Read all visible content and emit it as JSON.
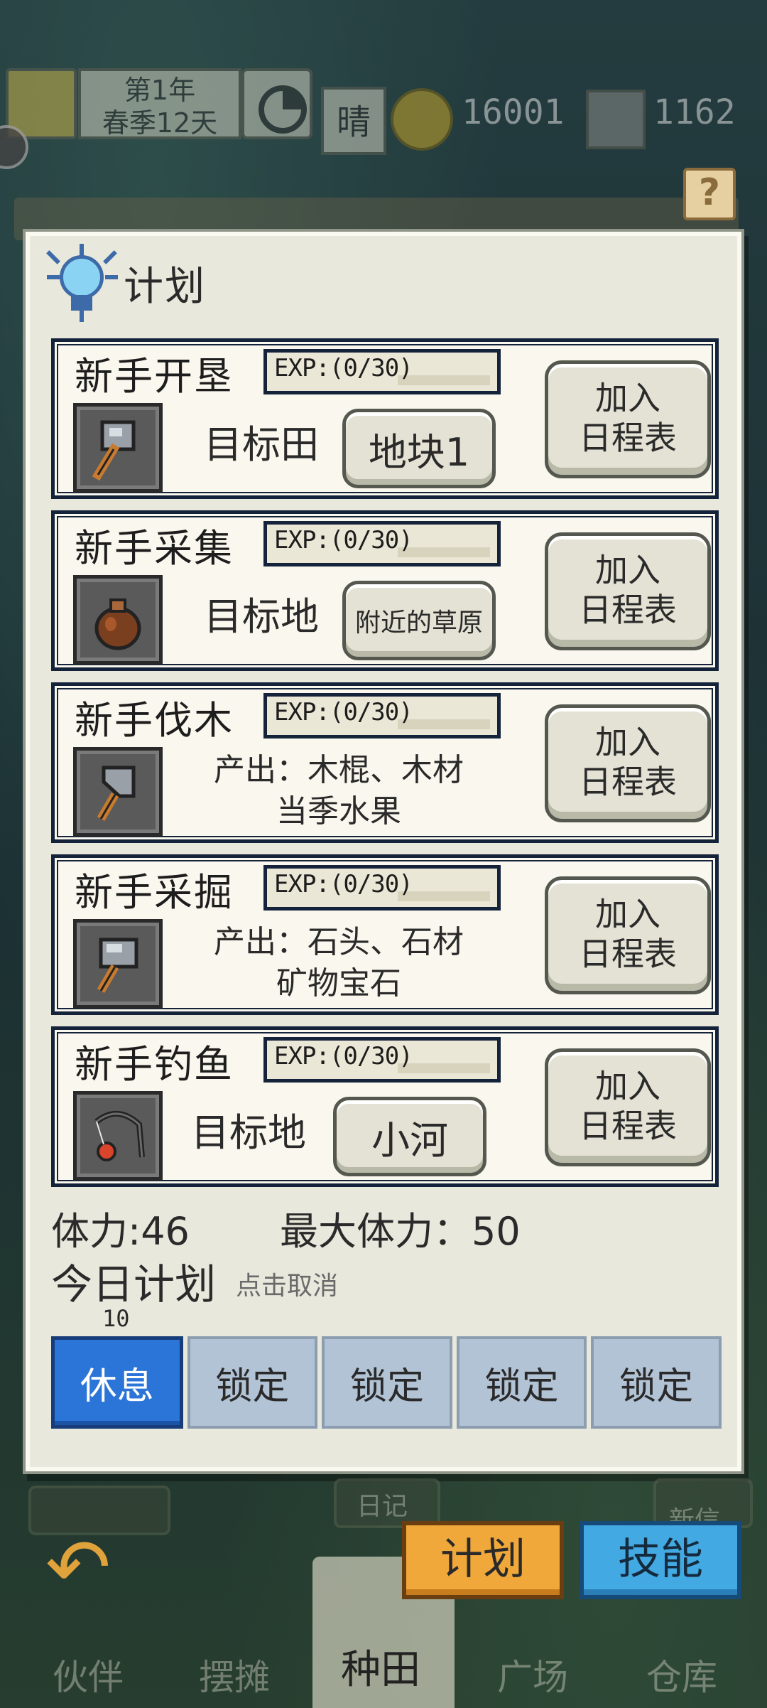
{
  "hud": {
    "date_line1": "第1年",
    "date_line2": "春季12天",
    "weather": "晴",
    "coins": "16001",
    "gems": "1162",
    "help": "?"
  },
  "panel": {
    "title": "计划",
    "tasks": [
      {
        "title": "新手开垦",
        "exp": "EXP:(0/30)",
        "exp_progress": 0,
        "icon": "hoe-icon",
        "target_label": "目标田",
        "target_value": "地块1",
        "add_line1": "加入",
        "add_line2": "日程表"
      },
      {
        "title": "新手采集",
        "exp": "EXP:(0/30)",
        "exp_progress": 0,
        "icon": "sack-icon",
        "target_label": "目标地",
        "target_value": "附近的草原",
        "add_line1": "加入",
        "add_line2": "日程表"
      },
      {
        "title": "新手伐木",
        "exp": "EXP:(0/30)",
        "exp_progress": 0,
        "icon": "axe-icon",
        "output_line1": "产出：木棍、木材",
        "output_line2": "当季水果",
        "add_line1": "加入",
        "add_line2": "日程表"
      },
      {
        "title": "新手采掘",
        "exp": "EXP:(0/30)",
        "exp_progress": 0,
        "icon": "hammer-icon",
        "output_line1": "产出：石头、石材",
        "output_line2": "矿物宝石",
        "add_line1": "加入",
        "add_line2": "日程表"
      },
      {
        "title": "新手钓鱼",
        "exp": "EXP:(0/30)",
        "exp_progress": 0,
        "icon": "fishing-rod-icon",
        "target_label": "目标地",
        "target_value": "小河",
        "add_line1": "加入",
        "add_line2": "日程表"
      }
    ],
    "stamina": "体力:46",
    "max_stamina": "最大体力：50",
    "today_plan": "今日计划",
    "today_hint": "点击取消",
    "slot_cost": "10",
    "slots": [
      "休息",
      "锁定",
      "锁定",
      "锁定",
      "锁定"
    ]
  },
  "bottom": {
    "plan": "计划",
    "skill": "技能",
    "farm": "种田",
    "partner": "伙伴",
    "stall": "摆摊",
    "plaza": "广场",
    "warehouse": "仓库",
    "diary": "日记",
    "news": "新信"
  }
}
